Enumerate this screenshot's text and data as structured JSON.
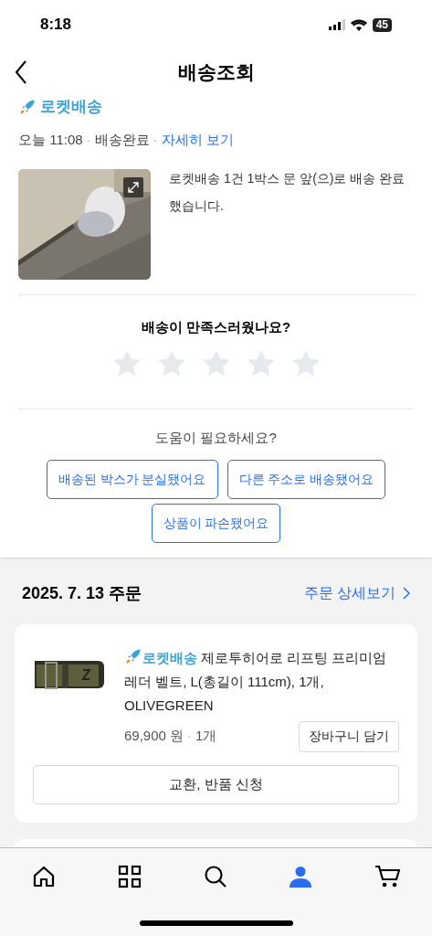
{
  "status_bar": {
    "time": "8:18",
    "battery": "45"
  },
  "header": {
    "title": "배송조회"
  },
  "delivery": {
    "brand": "로켓배송",
    "date": "오늘 11:08",
    "separator_1": "·",
    "status": "배송완료",
    "separator_2": "·",
    "detail_link": "자세히 보기",
    "message": "로켓배송 1건 1박스 문 앞(으)로 배송 완료했습니다."
  },
  "rating": {
    "question": "배송이 만족스러웠나요?",
    "stars": 0
  },
  "help": {
    "title": "도움이 필요하세요?",
    "buttons": [
      "배송된 박스가 분실됐어요",
      "다른 주소로 배송됐어요",
      "상품이 파손됐어요"
    ]
  },
  "order": {
    "date": "2025. 7. 13 주문",
    "detail_link": "주문 상세보기",
    "items": [
      {
        "badge": "로켓배송",
        "name": "제로투히어로 리프팅 프리미엄 레더 벨트, L(총길이 111cm), 1개, OLIVEGREEN",
        "price": "69,900 원",
        "separator": "·",
        "quantity": "1개",
        "cart_button": "장바구니 담기",
        "return_button": "교환, 반품 신청"
      }
    ]
  },
  "tab_bar": [
    {
      "kind": "home",
      "selected": false
    },
    {
      "kind": "categories",
      "selected": false
    },
    {
      "kind": "search",
      "selected": false
    },
    {
      "kind": "account",
      "selected": true
    },
    {
      "kind": "cart",
      "selected": false
    }
  ]
}
